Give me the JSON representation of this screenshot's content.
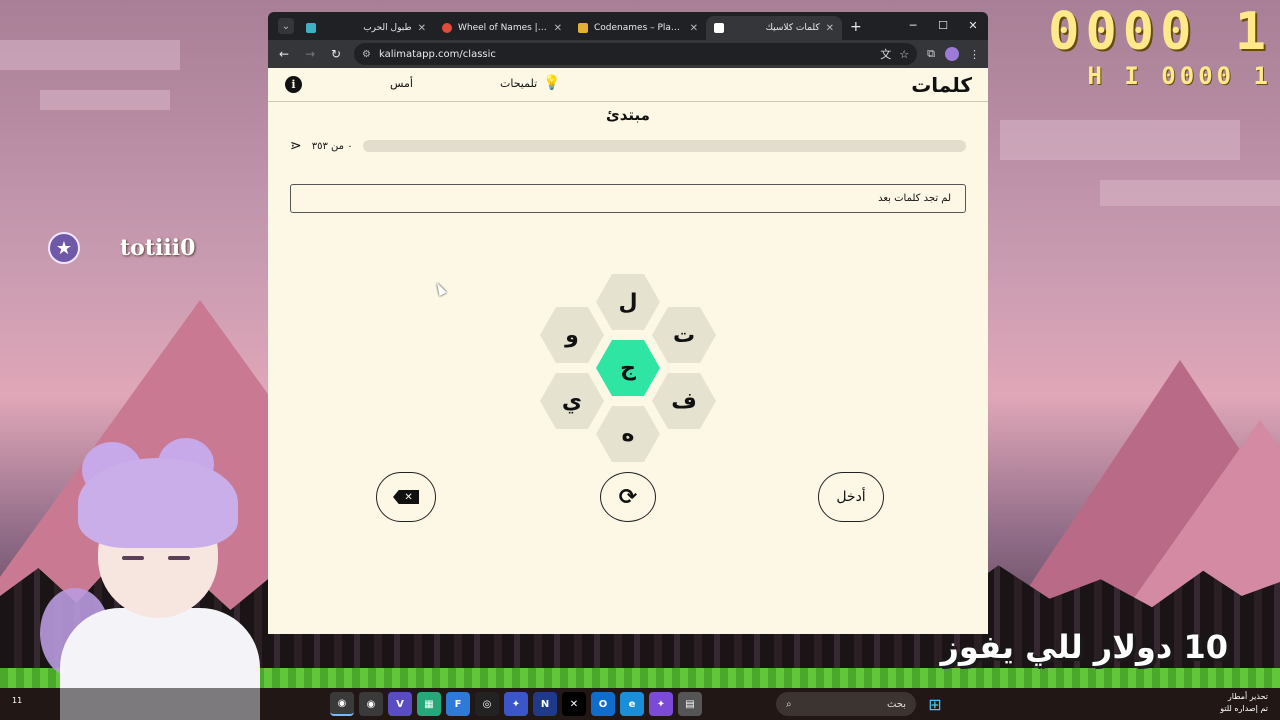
{
  "overlay": {
    "score": "0000 1",
    "hiscore": "H I  0000 1",
    "chat_username": "totiii0",
    "chat_badge_icon": "star-icon",
    "prize_text": "10 دولار للي يفوز",
    "clock": "11"
  },
  "browser": {
    "tabs": [
      {
        "title": "طبول الحرب",
        "active": false,
        "color": "#3fb1c7"
      },
      {
        "title": "Wheel of Names | عشوائي",
        "active": false,
        "color": "#e14b3b"
      },
      {
        "title": "Codenames – Play with y",
        "active": false,
        "color": "#e6b133"
      },
      {
        "title": "كلمات كلاسيك",
        "active": true,
        "color": "#ffffff"
      }
    ],
    "new_tab_label": "+",
    "url": "kalimatapp.com/classic"
  },
  "page": {
    "logo": "كلمات",
    "hints_label": "تلميحات",
    "yesterday_label": "أمس",
    "info_label": "i",
    "rank": "مبتدئ",
    "score_text": "٠ من ٣٥٣",
    "progress_fraction": 0,
    "found_words_text": "لم تجد كلمات بعد",
    "letters": {
      "center": "ج",
      "top": "ل",
      "top_right": "ت",
      "bottom_right": "ف",
      "bottom": "ه",
      "bottom_left": "ي",
      "top_left": "و"
    },
    "delete_icon": "delete-backspace-icon",
    "delete_glyph": "✕",
    "shuffle_icon": "shuffle-icon",
    "shuffle_glyph": "⟳",
    "enter_label": "أدخل"
  },
  "taskbar": {
    "search_label": "بحث",
    "notify_line1": "تحذير أمطار",
    "notify_line2": "تم إصداره للتو",
    "apps": [
      "chrome",
      "chrome",
      "vs",
      "app",
      "figma",
      "obs",
      "copilot",
      "notion",
      "x",
      "outlook",
      "edge",
      "copilot2",
      "files"
    ]
  }
}
